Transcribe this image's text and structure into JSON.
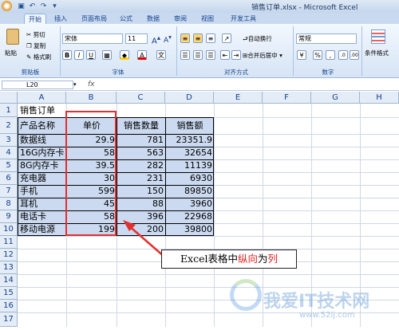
{
  "window": {
    "title": "销售订单.xlsx - Microsoft Excel"
  },
  "tabs": [
    "开始",
    "插入",
    "页面布局",
    "公式",
    "数据",
    "审阅",
    "视图",
    "开发工具"
  ],
  "ribbon": {
    "clipboard": {
      "paste": "粘贴",
      "cut": "剪切",
      "copy": "复制",
      "format_painter": "格式刷",
      "label": "剪贴板"
    },
    "font": {
      "name": "宋体",
      "size": "11",
      "label": "字体",
      "bold": "B",
      "italic": "I",
      "underline": "U"
    },
    "alignment": {
      "wrap": "自动换行",
      "merge": "合并后居中",
      "label": "对齐方式"
    },
    "number": {
      "format": "常规",
      "label": "数字",
      "percent": "%",
      "comma": ","
    },
    "styles": {
      "cond_format": "条件格式"
    }
  },
  "formula_bar": {
    "name_box": "L20",
    "fx": "fx",
    "value": ""
  },
  "columns": [
    "A",
    "B",
    "C",
    "D",
    "E",
    "F",
    "G",
    "H"
  ],
  "rows": [
    "1",
    "2",
    "3",
    "4",
    "5",
    "6",
    "7",
    "8",
    "9",
    "10",
    "11",
    "12",
    "13",
    "14",
    "15",
    "16",
    "17"
  ],
  "sheet": {
    "title": "销售订单",
    "headers": [
      "产品名称",
      "单价",
      "销售数量",
      "销售额"
    ],
    "data": [
      [
        "数据线",
        "29.9",
        "781",
        "23351.9"
      ],
      [
        "16G内存卡",
        "58",
        "563",
        "32654"
      ],
      [
        "8G内存卡",
        "39.5",
        "282",
        "11139"
      ],
      [
        "充电器",
        "30",
        "231",
        "6930"
      ],
      [
        "手机",
        "599",
        "150",
        "89850"
      ],
      [
        "耳机",
        "45",
        "88",
        "3960"
      ],
      [
        "电话卡",
        "58",
        "396",
        "22968"
      ],
      [
        "移动电源",
        "199",
        "200",
        "39800"
      ]
    ]
  },
  "annotation": {
    "prefix": "Excel表格中",
    "highlight1": "纵向",
    "middle": "为",
    "highlight2": "列",
    "highlight_color": "#e02020"
  },
  "watermark": {
    "text": "我爱IT技术网",
    "url": "www.52ij.com"
  },
  "colors": {
    "highlight_border": "#e03030",
    "selection_fill": "#cbdaf0",
    "accent": "#15428b"
  }
}
